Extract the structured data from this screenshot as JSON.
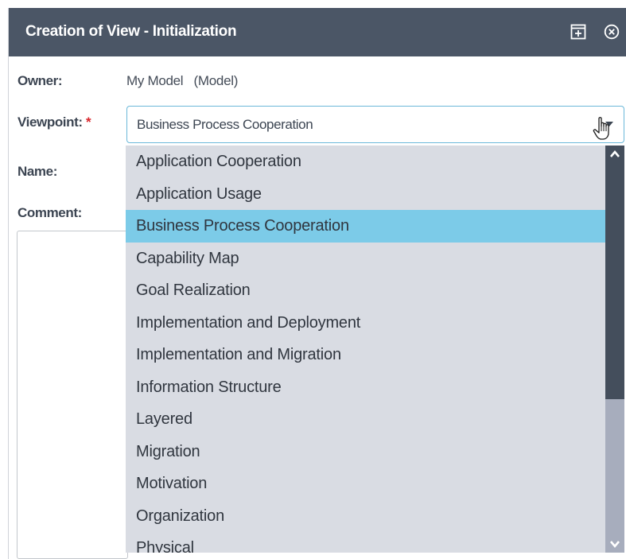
{
  "dialog": {
    "title": "Creation of View - Initialization"
  },
  "form": {
    "owner_label": "Owner:",
    "owner_value": "My Model   (Model)",
    "viewpoint_label": "Viewpoint: ",
    "required_marker": "*",
    "viewpoint_value": "Business Process Cooperation",
    "name_label": "Name:",
    "comment_label": "Comment:"
  },
  "dropdown": {
    "options": [
      "Application Cooperation",
      "Application Usage",
      "Business Process Cooperation",
      "Capability Map",
      "Goal Realization",
      "Implementation and Deployment",
      "Implementation and Migration",
      "Information Structure",
      "Layered",
      "Migration",
      "Motivation",
      "Organization",
      "Physical"
    ],
    "selected": "Business Process Cooperation"
  },
  "colors": {
    "titlebar": "#4b5666",
    "selected_option": "#7ccbe8",
    "dropdown_bg": "#d9dce3",
    "scroll_thumb": "#444e5c",
    "required": "#d9252b"
  },
  "icons": {
    "maximize": "maximize-icon",
    "close": "close-circle-icon",
    "select_arrow": "chevron-down-icon",
    "cursor": "hand-pointer-icon",
    "scroll_up": "chevron-up-icon",
    "scroll_down": "chevron-down-icon"
  }
}
